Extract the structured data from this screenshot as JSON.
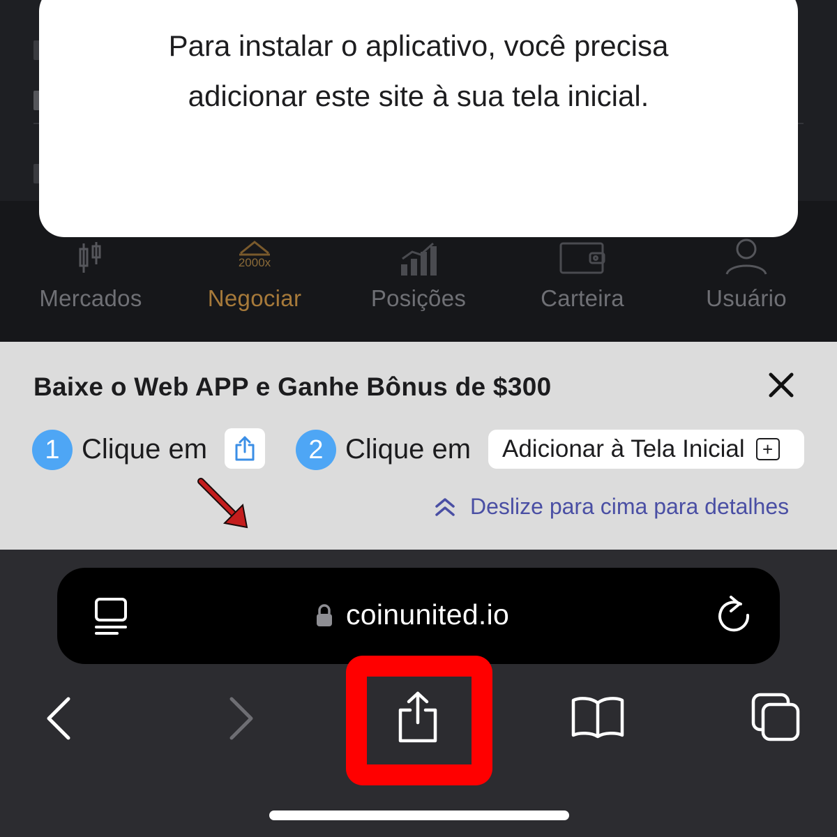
{
  "modal": {
    "line1": "Para instalar o aplicativo, você precisa",
    "line2": "adicionar este site à sua tela inicial."
  },
  "tabbar": {
    "leverage_badge": "2000x",
    "items": [
      {
        "label": "Mercados",
        "icon": "candlestick-icon",
        "active": false
      },
      {
        "label": "Negociar",
        "icon": "trade-icon",
        "active": true
      },
      {
        "label": "Posições",
        "icon": "bar-chart-icon",
        "active": false
      },
      {
        "label": "Carteira",
        "icon": "wallet-icon",
        "active": false
      },
      {
        "label": "Usuário",
        "icon": "user-icon",
        "active": false
      }
    ]
  },
  "banner": {
    "title": "Baixe o Web APP e Ganhe Bônus de $300",
    "step1_number": "1",
    "step1_text": "Clique em",
    "step2_number": "2",
    "step2_text": "Clique em",
    "add_to_home_label": "Adicionar à Tela Inicial",
    "add_to_home_symbol": "+",
    "swipe_hint": "Deslize para cima para detalhes"
  },
  "browser": {
    "url": "coinunited.io",
    "icons": [
      "reader-mode-icon",
      "lock-icon",
      "reload-icon",
      "back-icon",
      "forward-icon",
      "share-icon",
      "bookmarks-icon",
      "tabs-icon"
    ]
  },
  "colors": {
    "accent_active_tab": "#a77a3a",
    "step_badge": "#4ea6f5",
    "swipe_hint": "#4a4fa4",
    "highlight": "#ff0000"
  }
}
